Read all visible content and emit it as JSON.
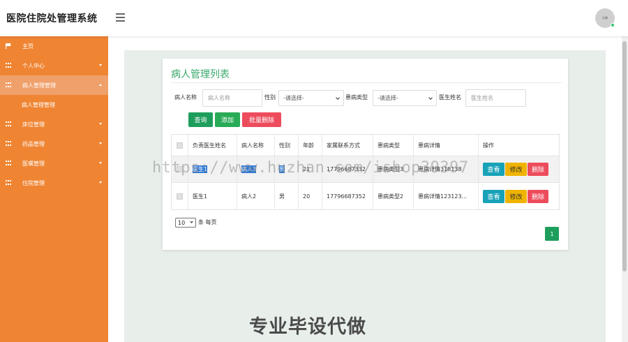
{
  "app": {
    "title": "医院住院处管理系统",
    "avatar_text": "头像"
  },
  "sidebar": {
    "items": [
      {
        "label": "主页",
        "icon": "flag-icon",
        "has_arrow": false
      },
      {
        "label": "个人中心",
        "icon": "grid-icon",
        "has_arrow": true
      },
      {
        "label": "病人管理管理",
        "icon": "grid-icon",
        "has_arrow": true,
        "open": true,
        "subitems": [
          "病人管理管理"
        ]
      },
      {
        "label": "床位管理",
        "icon": "grid-icon",
        "has_arrow": true
      },
      {
        "label": "药品管理",
        "icon": "grid-icon",
        "has_arrow": true
      },
      {
        "label": "医嘱管理",
        "icon": "grid-icon",
        "has_arrow": true
      },
      {
        "label": "住院管理",
        "icon": "grid-icon",
        "has_arrow": true
      }
    ]
  },
  "card": {
    "title": "病人管理列表"
  },
  "filters": {
    "patient_name_label": "病人名称",
    "patient_name_placeholder": "病人名称",
    "gender_label": "性别",
    "gender_value": "-请选择-",
    "disease_type_label": "患病类型",
    "disease_type_value": "-请选择-",
    "doctor_name_label": "医生姓名",
    "doctor_name_placeholder": "医生姓名"
  },
  "actions": {
    "search": "查询",
    "add": "添加",
    "batch_delete": "批量删除"
  },
  "table": {
    "columns": [
      "负责医生姓名",
      "病人名称",
      "性别",
      "年龄",
      "家属联系方式",
      "患病类型",
      "患病详情",
      "操作"
    ],
    "rows": [
      {
        "doctor": "医生1",
        "patient": "病人3",
        "gender": "男",
        "age": "21",
        "phone": "17796687332",
        "disease_type": "患病类型3",
        "detail": "患病详情318138",
        "selected": true
      },
      {
        "doctor": "医生1",
        "patient": "病人2",
        "gender": "男",
        "age": "20",
        "phone": "17796687352",
        "disease_type": "患病类型2",
        "detail": "患病详情123123...",
        "selected": false
      }
    ],
    "row_actions": {
      "view": "查看",
      "edit": "修改",
      "delete": "删除"
    }
  },
  "pager": {
    "page_size": "10",
    "per_page_text": "条 每页",
    "current_page": "1"
  },
  "overlay": {
    "watermark": "https://www.huzhan.com/ishop39397",
    "promo": "专业毕设代做"
  },
  "colors": {
    "sidebar": "#ef8533",
    "accent_green": "#1e9e5c",
    "danger": "#ed4c5c",
    "info": "#17a2b8",
    "warning": "#f0b400",
    "title_green": "#3aa86b"
  }
}
